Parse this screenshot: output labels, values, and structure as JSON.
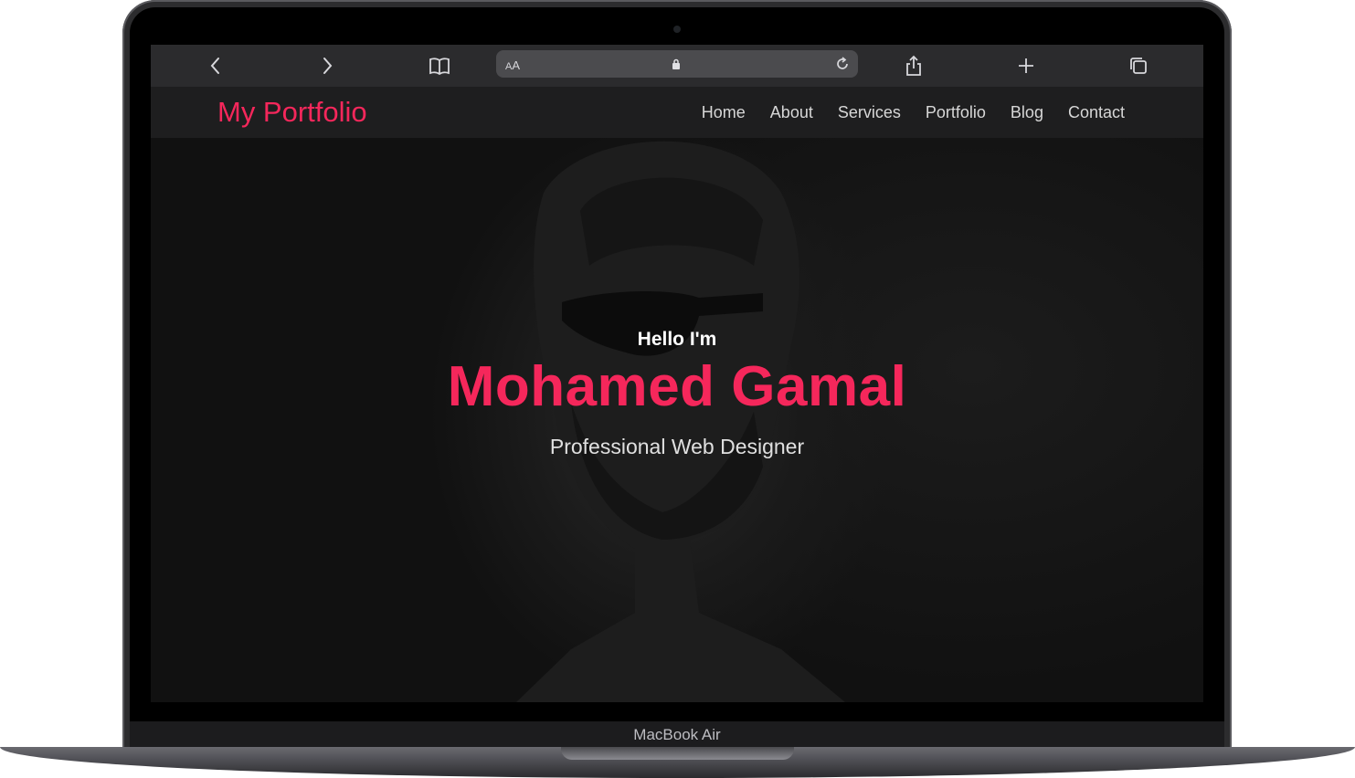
{
  "device": {
    "label": "MacBook Air"
  },
  "browser": {
    "url_text_size_label_small": "A",
    "url_text_size_label_big": "A"
  },
  "site": {
    "logo": "My Portfolio",
    "nav": [
      "Home",
      "About",
      "Services",
      "Portfolio",
      "Blog",
      "Contact"
    ]
  },
  "hero": {
    "greeting": "Hello I'm",
    "name": "Mohamed Gamal",
    "title": "Professional Web Designer"
  },
  "colors": {
    "accent": "#f5275b",
    "nav_bg": "#1e1e1f",
    "toolbar_bg": "#2b2b2d"
  },
  "icons": [
    "back-icon",
    "forward-icon",
    "bookmarks-icon",
    "lock-icon",
    "reload-icon",
    "share-icon",
    "new-tab-icon",
    "tabs-icon"
  ]
}
